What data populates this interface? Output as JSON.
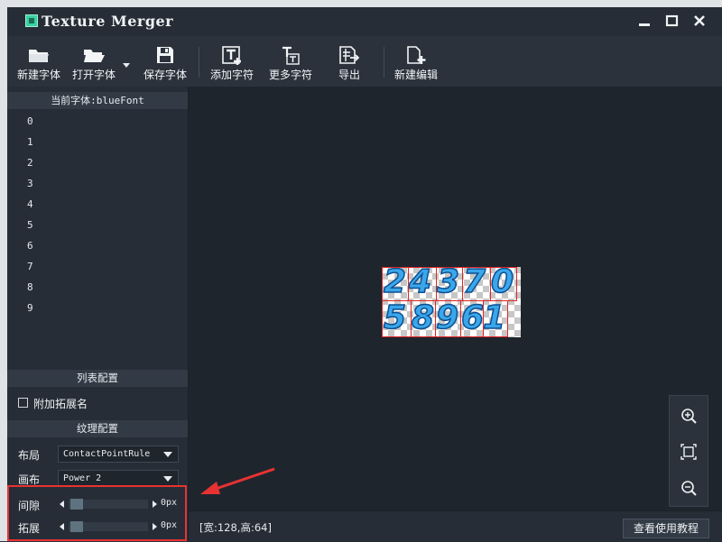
{
  "window": {
    "title": "Texture Merger",
    "minimize_icon": "minimize-icon",
    "maximize_icon": "maximize-icon",
    "close_icon": "close-icon"
  },
  "toolbar": {
    "items": [
      {
        "label": "新建字体",
        "icon": "folder-new-icon"
      },
      {
        "label": "打开字体",
        "icon": "folder-open-icon"
      },
      {
        "label": "保存字体",
        "icon": "save-icon"
      },
      {
        "label": "添加字符",
        "icon": "add-text-icon"
      },
      {
        "label": "更多字符",
        "icon": "more-text-icon"
      },
      {
        "label": "导出",
        "icon": "export-icon"
      },
      {
        "label": "新建编辑",
        "icon": "new-doc-icon"
      }
    ]
  },
  "left_panel": {
    "current_font": "当前字体:blueFont",
    "characters": [
      "0",
      "1",
      "2",
      "3",
      "4",
      "5",
      "6",
      "7",
      "8",
      "9"
    ],
    "list_config_header": "列表配置",
    "append_ext_label": "附加拓展名",
    "append_ext_checked": false,
    "texture_config_header": "纹理配置",
    "layout_label": "布局",
    "layout_value": "ContactPointRule",
    "canvas_label": "画布",
    "canvas_value": "Power 2",
    "gap_label": "间隙",
    "gap_value": "0px",
    "extend_label": "拓展",
    "extend_value": "0px"
  },
  "canvas": {
    "atlas_row1": [
      "2",
      "4",
      "3",
      "7",
      "0"
    ],
    "atlas_row2": [
      "5",
      "8",
      "9",
      "6",
      "1"
    ],
    "glyph_color": "#3aa7ea",
    "grid_color": "#e02424"
  },
  "zoom": {
    "zoom_in_icon": "zoom-in-icon",
    "fit_icon": "fit-screen-icon",
    "zoom_out_icon": "zoom-out-icon"
  },
  "statusbar": {
    "size_text": "[宽:128,高:64]",
    "help_button": "查看使用教程"
  },
  "annotation": {
    "color": "#e83232"
  }
}
